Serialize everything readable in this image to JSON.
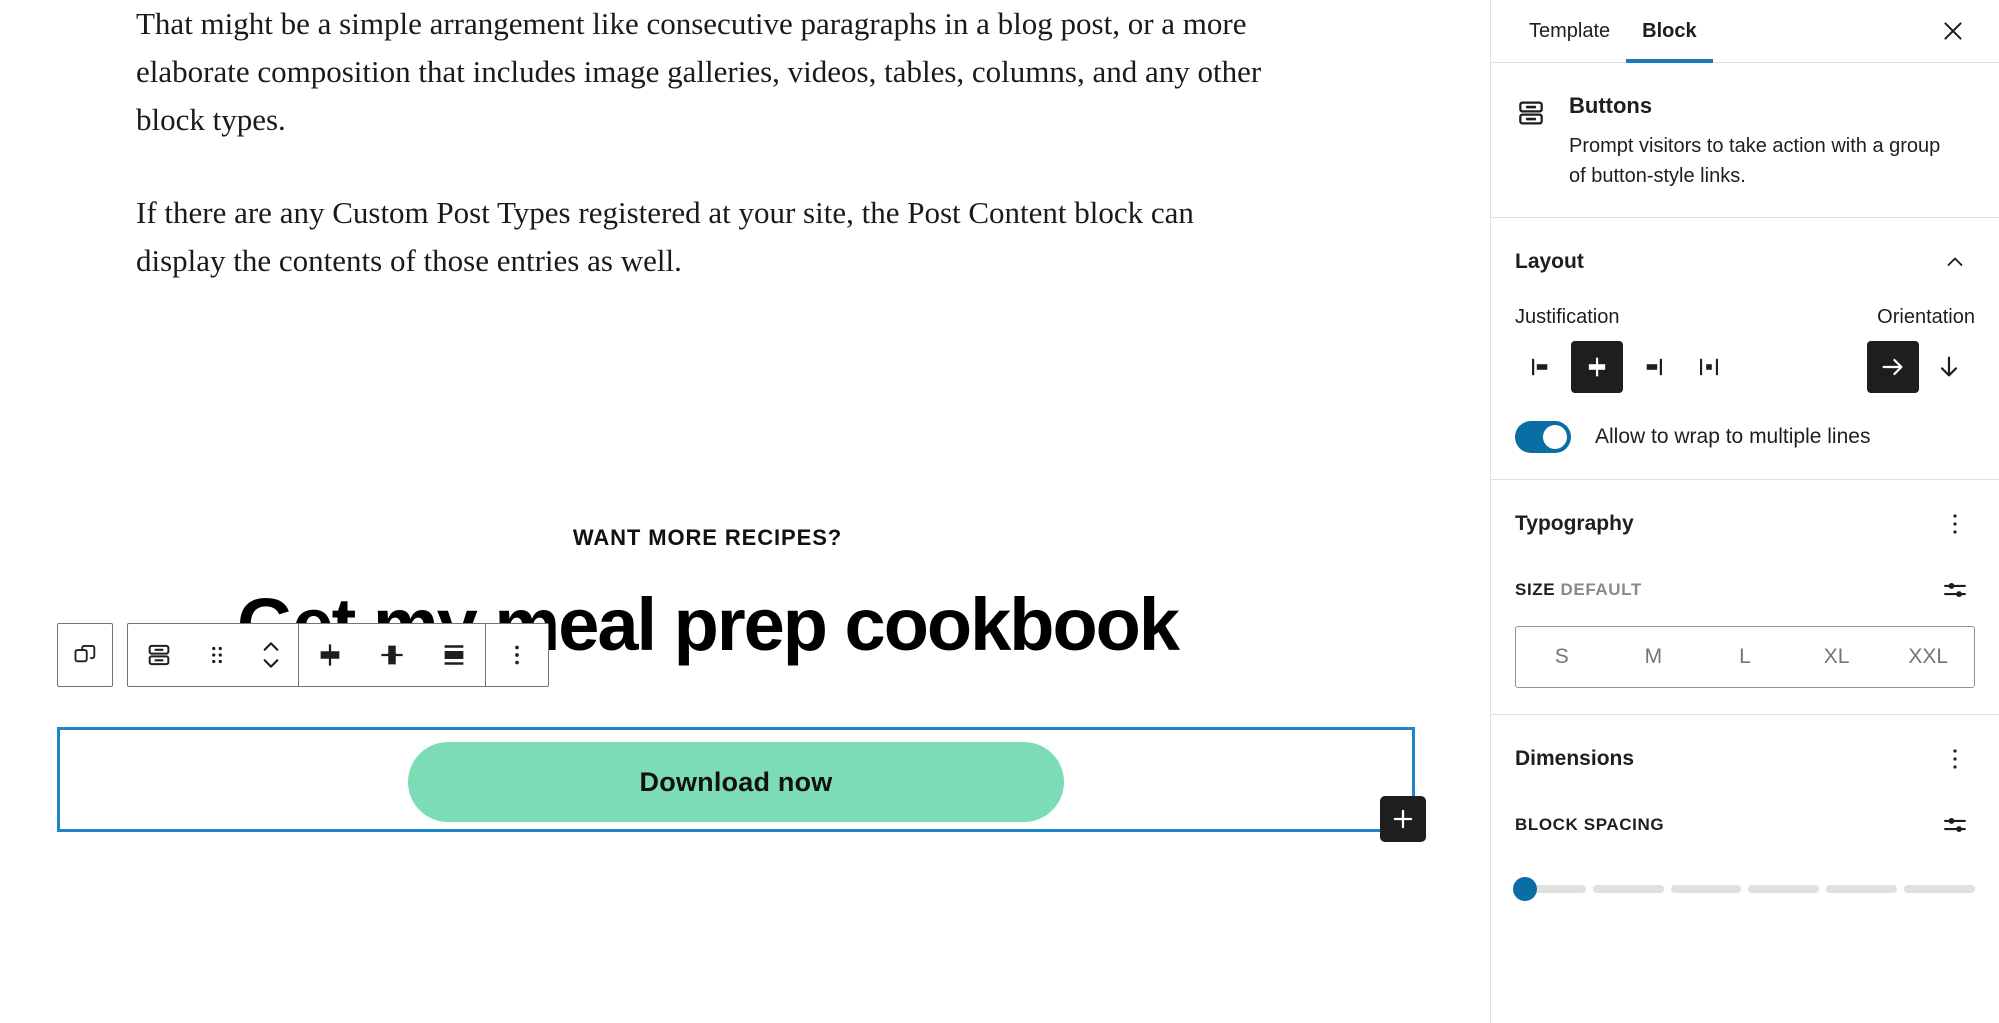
{
  "canvas": {
    "paragraphs": [
      "That might be a simple arrangement like consecutive paragraphs in a blog post, or a more elaborate composition that includes image galleries, videos, tables, columns, and any other block types.",
      "If there are any Custom Post Types registered at your site, the Post Content block can display the contents of those entries as well."
    ],
    "kicker": "WANT MORE RECIPES?",
    "heading": "Get my meal prep cookbook",
    "button_label": "Download now",
    "button_color": "#7bdcb5",
    "selection_color": "#1f85c9",
    "add_button_label": "Add block"
  },
  "toolbar": {
    "select_parent_label": "Select Buttons",
    "block_icon_label": "Buttons",
    "drag_label": "Drag",
    "move_label": "Move up or down",
    "align_center_label": "Justify items center",
    "align_vertical_center_label": "Align items center",
    "stretch_label": "Stretch items",
    "options_label": "Options"
  },
  "sidebar": {
    "tabs": [
      {
        "label": "Template",
        "active": false
      },
      {
        "label": "Block",
        "active": true
      }
    ],
    "close_label": "Close Settings",
    "active_tab_underline": "#1a7bb9",
    "block_card": {
      "icon": "buttons-icon",
      "title": "Buttons",
      "description": "Prompt visitors to take action with a group of button-style links."
    },
    "layout": {
      "title": "Layout",
      "collapse_icon": "chevron-up-icon",
      "justification_label": "Justification",
      "orientation_label": "Orientation",
      "justification_options": [
        {
          "name": "justify-left",
          "selected": false
        },
        {
          "name": "justify-center",
          "selected": true
        },
        {
          "name": "justify-right",
          "selected": false
        },
        {
          "name": "space-between",
          "selected": false
        }
      ],
      "orientation_options": [
        {
          "name": "horizontal",
          "selected": true
        },
        {
          "name": "vertical",
          "selected": false
        }
      ],
      "wrap_toggle": {
        "label": "Allow to wrap to multiple lines",
        "enabled": true,
        "color": "#0a6ea4"
      }
    },
    "typography": {
      "title": "Typography",
      "menu_icon": "more-vertical-icon",
      "size_label": "SIZE",
      "size_value": "DEFAULT",
      "reset_icon": "settings-sliders-icon",
      "size_options": [
        "S",
        "M",
        "L",
        "XL",
        "XXL"
      ]
    },
    "dimensions": {
      "title": "Dimensions",
      "menu_icon": "more-vertical-icon",
      "block_spacing_label": "BLOCK SPACING",
      "reset_icon": "settings-sliders-icon",
      "slider_value": 0,
      "slider_steps": 6,
      "slider_color": "#0a6ea4"
    }
  }
}
